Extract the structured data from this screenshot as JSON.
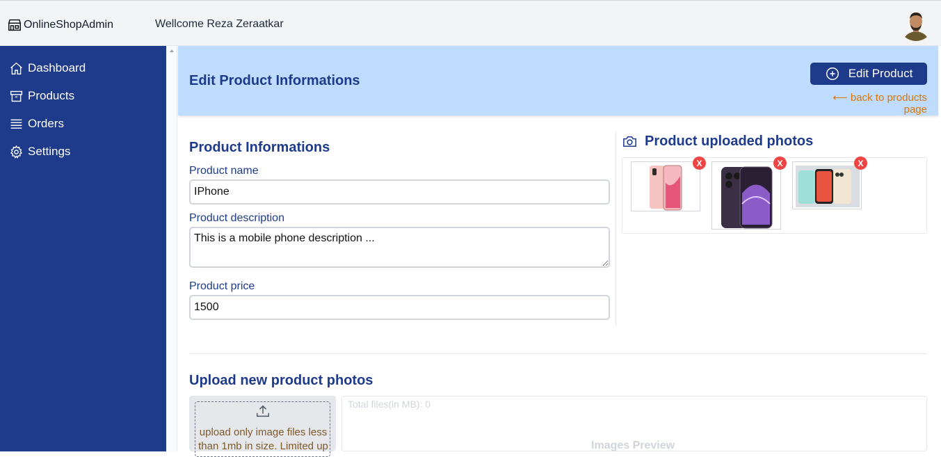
{
  "header": {
    "brand": "OnlineShopAdmin",
    "welcome": "Wellcome Reza Zeraatkar"
  },
  "sidebar": {
    "items": [
      {
        "label": "Dashboard",
        "icon": "home-icon"
      },
      {
        "label": "Products",
        "icon": "archive-icon"
      },
      {
        "label": "Orders",
        "icon": "list-icon"
      },
      {
        "label": "Settings",
        "icon": "gear-icon"
      }
    ]
  },
  "banner": {
    "title": "Edit Product Informations",
    "edit_button": "Edit Product",
    "back_link": "⟵ back to products page"
  },
  "form": {
    "title": "Product Informations",
    "name_label": "Product name",
    "name_value": "IPhone",
    "description_label": "Product description",
    "description_value": "This is a mobile phone description ...",
    "price_label": "Product price",
    "price_value": "1500"
  },
  "photos": {
    "title": "Product uploaded photos",
    "remove_label": "X"
  },
  "upload": {
    "title": "Upload new product photos",
    "instructions": "upload only image files less than 1mb in size. Limited up",
    "total_files": "Total files(in MB): 0",
    "preview_label": "Images Preview"
  },
  "colors": {
    "sidebar": "#1e3a8a",
    "banner": "#bfdbfe",
    "accent_link": "#d97706",
    "remove_badge": "#ef4444"
  }
}
